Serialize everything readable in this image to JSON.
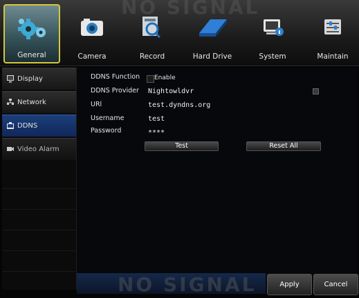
{
  "watermark": "NO SIGNAL",
  "tabs": [
    {
      "label": "General",
      "icon": "gears-icon"
    },
    {
      "label": "Camera",
      "icon": "camera-icon"
    },
    {
      "label": "Record",
      "icon": "record-icon"
    },
    {
      "label": "Hard Drive",
      "icon": "hard-drive-icon"
    },
    {
      "label": "System",
      "icon": "system-icon"
    },
    {
      "label": "Maintain",
      "icon": "maintain-icon"
    }
  ],
  "sidebar": {
    "items": [
      {
        "label": "Display",
        "icon": "display-icon"
      },
      {
        "label": "Network",
        "icon": "network-icon"
      },
      {
        "label": "DDNS",
        "icon": "ddns-icon"
      },
      {
        "label": "Video Alarm",
        "icon": "video-alarm-icon"
      }
    ]
  },
  "ddns": {
    "function_label": "DDNS Function",
    "enable_label": "Enable",
    "provider_label": "DDNS Provider",
    "provider_value": "Nightowldvr",
    "url_label": "URl",
    "url_value": "test.dyndns.org",
    "username_label": "Username",
    "username_value": "test",
    "password_label": "Password",
    "password_value": "****",
    "test_button": "Test",
    "reset_button": "Reset All"
  },
  "footer": {
    "apply": "Apply",
    "cancel": "Cancel"
  },
  "colors": {
    "accent_active_tab_border": "#d4c93a",
    "sidebar_active": "#1b3f7a"
  }
}
